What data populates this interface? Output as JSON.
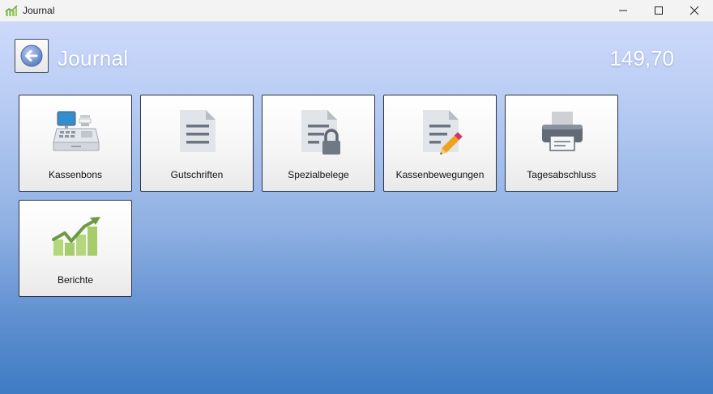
{
  "window": {
    "title": "Journal",
    "controls": {
      "minimize": "minimize-icon",
      "maximize": "maximize-icon",
      "close": "close-icon"
    }
  },
  "header": {
    "back_icon": "arrow-left-icon",
    "title": "Journal",
    "total": "149,70"
  },
  "tiles": [
    {
      "id": "kassenbons",
      "label": "Kassenbons",
      "icon": "cash-register-icon"
    },
    {
      "id": "gutschriften",
      "label": "Gutschriften",
      "icon": "document-icon"
    },
    {
      "id": "spezialbelege",
      "label": "Spezialbelege",
      "icon": "document-lock-icon"
    },
    {
      "id": "kassenbewegungen",
      "label": "Kassenbewegungen",
      "icon": "document-pencil-icon"
    },
    {
      "id": "tagesabschluss",
      "label": "Tagesabschluss",
      "icon": "printer-icon"
    },
    {
      "id": "berichte",
      "label": "Berichte",
      "icon": "growth-chart-icon"
    }
  ],
  "colors": {
    "background_top": "#cdd9fb",
    "background_bottom": "#3f7cc3",
    "tile_border": "#2c3446",
    "chart_green": "#8ab94c"
  }
}
